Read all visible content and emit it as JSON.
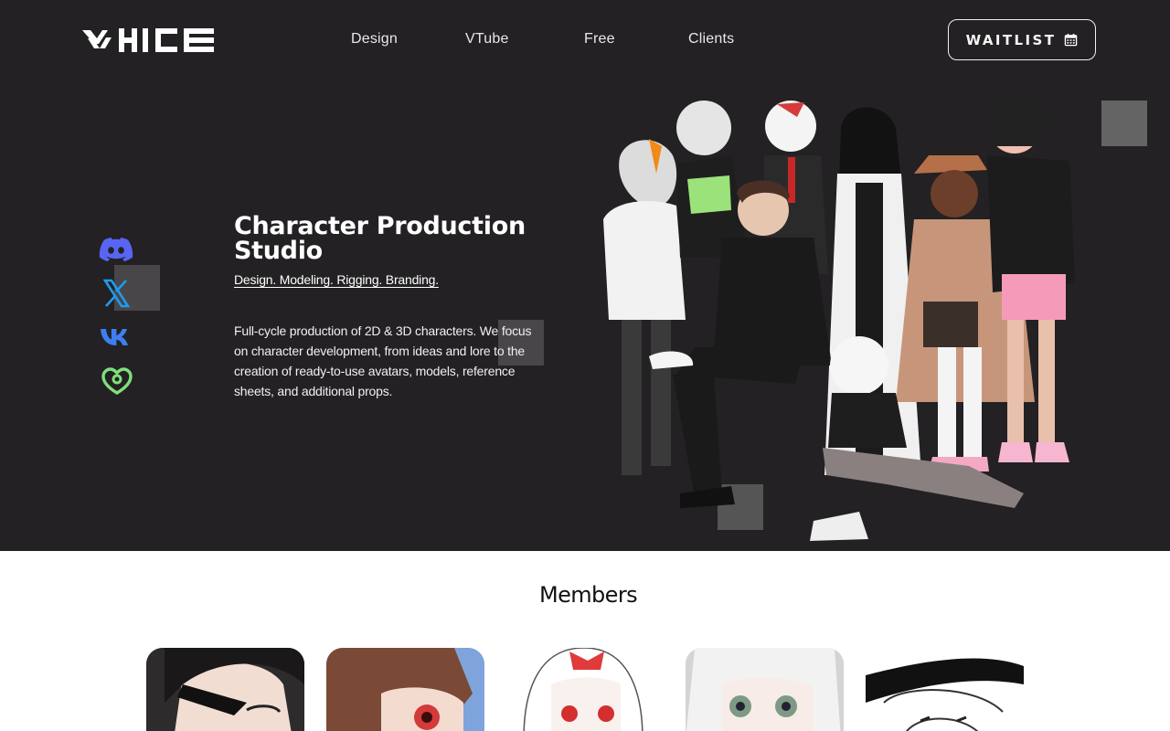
{
  "header": {
    "nav": [
      "Design",
      "VTube",
      "Free",
      "Clients"
    ],
    "waitlist_label": "WAITLIST"
  },
  "hero": {
    "title": "Character Production Studio",
    "tagline": "Design. Modeling. Rigging. Branding.",
    "description": "Full-cycle production of 2D & 3D characters. We focus on character development, from ideas and lore to the creation of ready-to-use avatars, models, reference sheets, and additional props."
  },
  "social": {
    "icons": [
      "discord-icon",
      "x-icon",
      "vk-icon",
      "boosty-icon"
    ],
    "colors": {
      "discord": "#5865f2",
      "x": "#1d9bf0",
      "vk": "#3d7ef0",
      "boosty": "#7ee07a"
    }
  },
  "members": {
    "title": "Members"
  },
  "colors": {
    "hero_bg": "#232123",
    "page_bg": "#ffffff",
    "text_light": "#ffffff"
  }
}
